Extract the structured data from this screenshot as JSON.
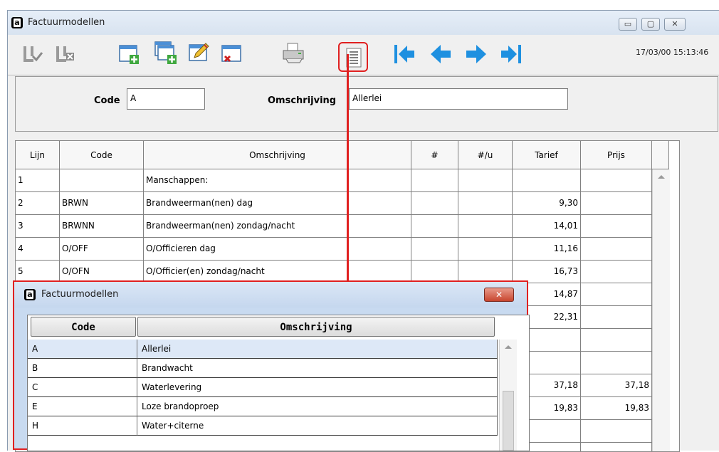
{
  "window": {
    "title": "Factuurmodellen",
    "datetime": "17/03/00 15:13:46",
    "minimize_label": "▭",
    "maximize_label": "▢",
    "close_label": "✕"
  },
  "form": {
    "code_label": "Code",
    "code_value": "A",
    "desc_label": "Omschrijving",
    "desc_value": "Allerlei"
  },
  "grid": {
    "columns": [
      "Lijn",
      "Code",
      "Omschrijving",
      "#",
      "#/u",
      "Tarief",
      "Prijs"
    ],
    "rows": [
      [
        "1",
        "",
        "Manschappen:",
        "",
        "",
        "",
        ""
      ],
      [
        "2",
        "BRWN",
        "Brandweerman(nen) dag",
        "",
        "",
        "9,30",
        ""
      ],
      [
        "3",
        "BRWNN",
        "Brandweerman(nen) zondag/nacht",
        "",
        "",
        "14,01",
        ""
      ],
      [
        "4",
        "O/OFF",
        "O/Officieren dag",
        "",
        "",
        "11,16",
        ""
      ],
      [
        "5",
        "O/OFN",
        "O/Officier(en) zondag/nacht",
        "",
        "",
        "16,73",
        ""
      ],
      [
        "",
        "",
        "",
        "",
        "",
        "14,87",
        ""
      ],
      [
        "",
        "",
        "",
        "",
        "",
        "22,31",
        ""
      ],
      [
        "",
        "",
        "",
        "",
        "",
        "",
        ""
      ],
      [
        "",
        "",
        "",
        "",
        "",
        "",
        ""
      ],
      [
        "",
        "",
        "",
        "",
        "",
        "37,18",
        "37,18"
      ],
      [
        "",
        "",
        "",
        "",
        "",
        "19,83",
        "19,83"
      ],
      [
        "",
        "",
        "",
        "",
        "",
        "",
        ""
      ],
      [
        "",
        "",
        "",
        "",
        "",
        "",
        ""
      ]
    ]
  },
  "popup": {
    "title": "Factuurmodellen",
    "close_label": "✕",
    "columns": [
      "Code",
      "Omschrijving"
    ],
    "rows": [
      [
        "A",
        "Allerlei"
      ],
      [
        "B",
        "Brandwacht"
      ],
      [
        "C",
        "Waterlevering"
      ],
      [
        "E",
        "Loze brandoproep"
      ],
      [
        "H",
        "Water+citerne"
      ]
    ]
  },
  "icons": {
    "save": "save-check-icon",
    "cancel": "save-cancel-icon",
    "new": "new-window-icon",
    "copy": "copy-window-icon",
    "edit": "edit-pencil-icon",
    "delete": "delete-window-icon",
    "print": "printer-icon",
    "list": "list-document-icon",
    "first": "first-record-icon",
    "prev": "previous-record-icon",
    "next": "next-record-icon",
    "last": "last-record-icon"
  },
  "colors": {
    "highlight": "#e02020",
    "nav_arrow": "#1e90e0"
  }
}
